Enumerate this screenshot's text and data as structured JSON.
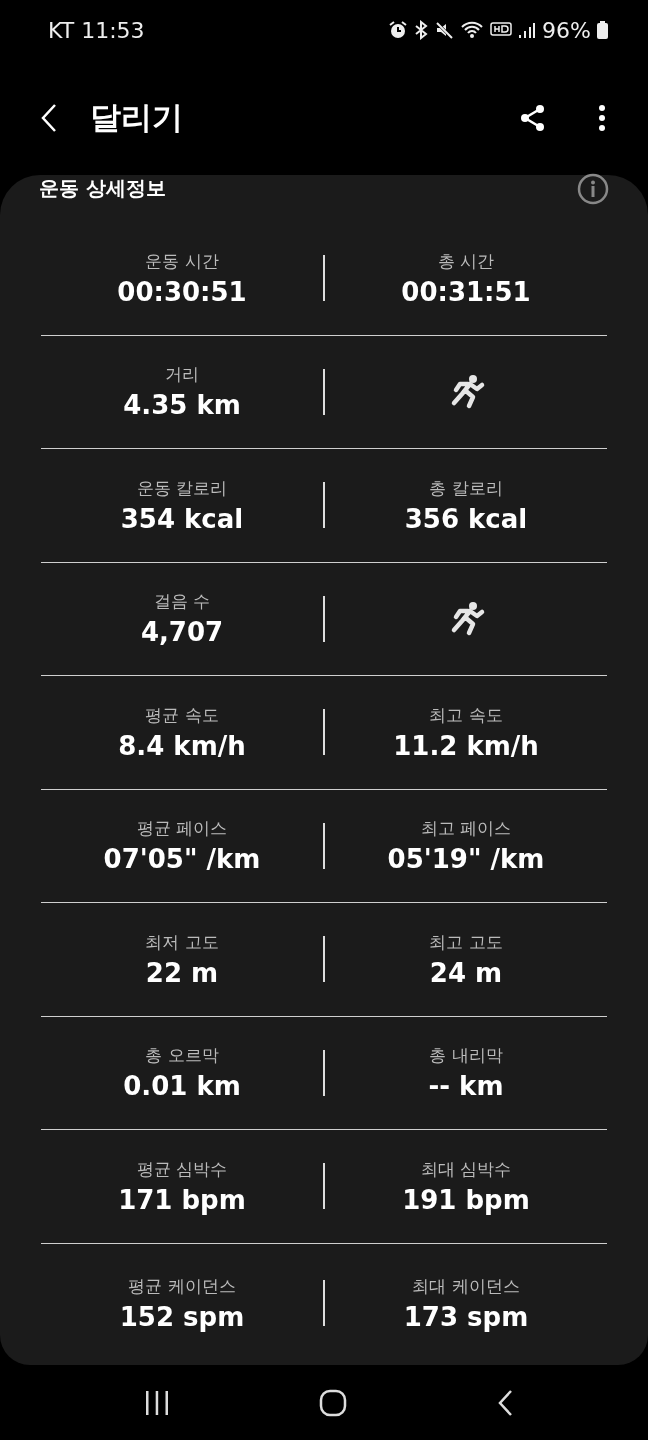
{
  "status_bar": {
    "carrier_time": "KT 11:53",
    "battery": "96%"
  },
  "header": {
    "title": "달리기"
  },
  "card": {
    "title": "운동 상세정보"
  },
  "rows": [
    {
      "left": {
        "kind": "stat",
        "label": "운동 시간",
        "value": "00:30:51"
      },
      "right": {
        "kind": "stat",
        "label": "총 시간",
        "value": "00:31:51"
      }
    },
    {
      "left": {
        "kind": "stat",
        "label": "거리",
        "value": "4.35 km"
      },
      "right": {
        "kind": "icon"
      }
    },
    {
      "left": {
        "kind": "stat",
        "label": "운동 칼로리",
        "value": "354 kcal"
      },
      "right": {
        "kind": "stat",
        "label": "총 칼로리",
        "value": "356 kcal"
      }
    },
    {
      "left": {
        "kind": "stat",
        "label": "걸음 수",
        "value": "4,707"
      },
      "right": {
        "kind": "icon"
      }
    },
    {
      "left": {
        "kind": "stat",
        "label": "평균 속도",
        "value": "8.4 km/h"
      },
      "right": {
        "kind": "stat",
        "label": "최고 속도",
        "value": "11.2 km/h"
      }
    },
    {
      "left": {
        "kind": "stat",
        "label": "평균 페이스",
        "value": "07'05\" /km"
      },
      "right": {
        "kind": "stat",
        "label": "최고 페이스",
        "value": "05'19\" /km"
      }
    },
    {
      "left": {
        "kind": "stat",
        "label": "최저 고도",
        "value": "22 m"
      },
      "right": {
        "kind": "stat",
        "label": "최고 고도",
        "value": "24 m"
      }
    },
    {
      "left": {
        "kind": "stat",
        "label": "총 오르막",
        "value": "0.01 km"
      },
      "right": {
        "kind": "stat",
        "label": "총 내리막",
        "value": "-- km"
      }
    },
    {
      "left": {
        "kind": "stat",
        "label": "평균 심박수",
        "value": "171 bpm"
      },
      "right": {
        "kind": "stat",
        "label": "최대 심박수",
        "value": "191 bpm"
      }
    },
    {
      "left": {
        "kind": "stat",
        "label": "평균 케이던스",
        "value": "152 spm"
      },
      "right": {
        "kind": "stat",
        "label": "최대 케이던스",
        "value": "173 spm"
      }
    }
  ]
}
